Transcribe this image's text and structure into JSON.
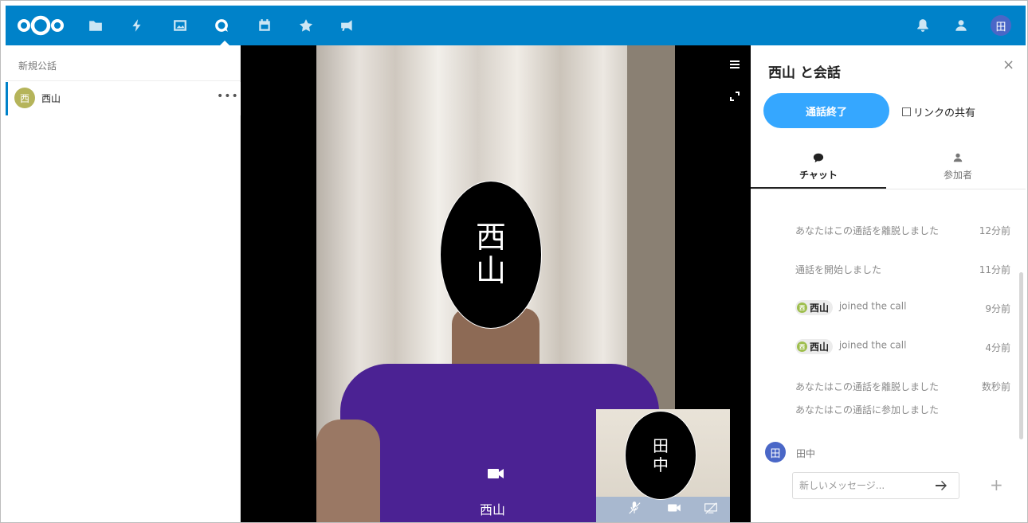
{
  "header": {
    "user_initial": "田",
    "nav": [
      {
        "name": "files-icon"
      },
      {
        "name": "activity-icon"
      },
      {
        "name": "gallery-icon"
      },
      {
        "name": "talk-icon",
        "active": true
      },
      {
        "name": "calendar-icon"
      },
      {
        "name": "favorites-icon"
      },
      {
        "name": "announcements-icon"
      }
    ],
    "accent": "#0082c9"
  },
  "left": {
    "new_conversation": "新規公話",
    "conversations": [
      {
        "initial": "西",
        "name": "西山",
        "more": "•••"
      }
    ]
  },
  "video": {
    "remote_face_text_line1": "西",
    "remote_face_text_line2": "山",
    "remote_name": "西山",
    "self_face_line1": "田",
    "self_face_line2": "中"
  },
  "right": {
    "title": "西山 と会話",
    "close": "×",
    "end_call": "通話終了",
    "share_link": "リンクの共有",
    "tabs": {
      "chat": "チャット",
      "participants": "参加者"
    },
    "messages": [
      {
        "text": "あなたはこの通話を離脱しました",
        "time": "12分前"
      },
      {
        "text": "通話を開始しました",
        "time": "11分前"
      },
      {
        "chip_initial": "西",
        "chip_name": "西山",
        "text": "joined the call",
        "time": "9分前"
      },
      {
        "chip_initial": "西",
        "chip_name": "西山",
        "text": "joined the call",
        "time": "4分前"
      },
      {
        "text": "あなたはこの通話を離脱しました",
        "time": "数秒前"
      },
      {
        "text": "あなたはこの通話に参加しました",
        "time": ""
      }
    ],
    "me_initial": "田",
    "me_name": "田中",
    "input_placeholder": "新しいメッセージ...",
    "plus": "+"
  }
}
